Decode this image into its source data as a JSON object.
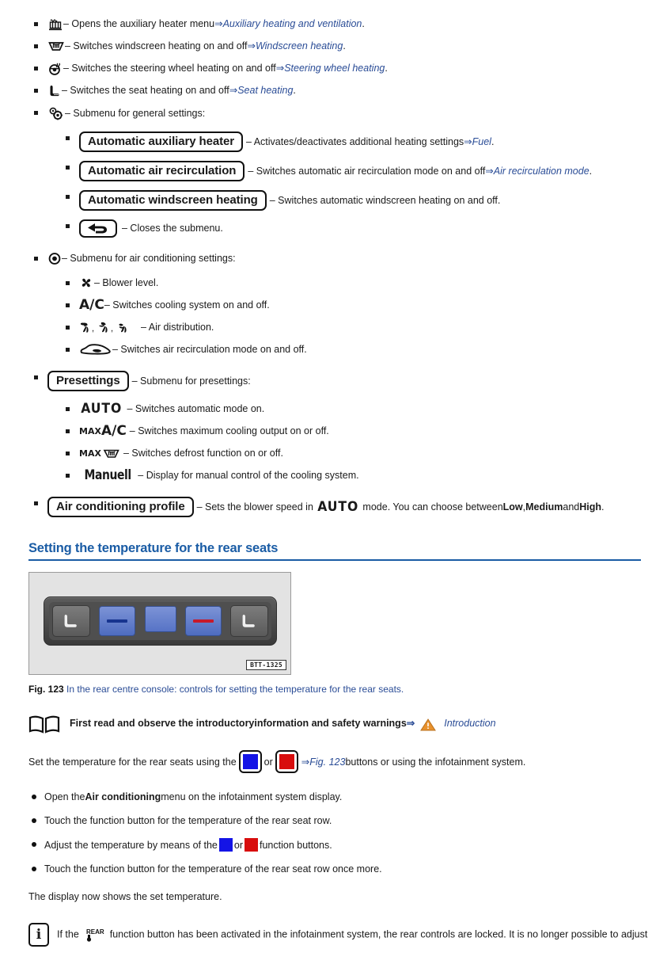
{
  "top_list": [
    {
      "icon": "auxiliary-heater-icon",
      "text": " – Opens the auxiliary heater menu ",
      "ref_arrow": "⇒ ",
      "ref": "Auxiliary heating and ventilation",
      "tail": "."
    },
    {
      "icon": "windscreen-heating-icon",
      "text": " – Switches windscreen heating on and off ",
      "ref_arrow": "⇒ ",
      "ref": "Windscreen heating",
      "tail": "."
    },
    {
      "icon": "steering-wheel-heating-icon",
      "text": " – Switches the steering wheel heating on and off ",
      "ref_arrow": "⇒ ",
      "ref": "Steering wheel heating",
      "tail": "."
    },
    {
      "icon": "seat-heating-icon",
      "text": " – Switches the seat heating on and off ",
      "ref_arrow": "⇒ ",
      "ref": "Seat heating",
      "tail": "."
    },
    {
      "icon": "general-settings-gear-icon",
      "text": " – Submenu for general settings:",
      "ref_arrow": "",
      "ref": "",
      "tail": ""
    }
  ],
  "general_settings": [
    {
      "label": "Automatic auxiliary heater",
      "text": " – Activates/deactivates additional heating settings ",
      "ref_arrow": "⇒ ",
      "ref": "Fuel",
      "tail": "."
    },
    {
      "label": "Automatic air recirculation",
      "text": " – Switches automatic air recirculation mode on and off ",
      "ref_arrow": "⇒ ",
      "ref": "Air recirculation mode",
      "tail": "."
    },
    {
      "label": "Automatic windscreen heating",
      "text": " – Switches automatic windscreen heating on and off.",
      "ref_arrow": "",
      "ref": "",
      "tail": ""
    },
    {
      "label": "",
      "icon": "back-arrow-icon",
      "text": " – Closes the submenu.",
      "ref_arrow": "",
      "ref": "",
      "tail": ""
    }
  ],
  "ac_settings_header": {
    "icon": "target-dot-icon",
    "text": " – Submenu for air conditioning settings:"
  },
  "ac_settings": [
    {
      "icon": "blower-fan-icon",
      "text": " – Blower level."
    },
    {
      "icon": "ac-text-icon",
      "text": " – Switches cooling system on and off."
    },
    {
      "icon": "air-distribution-icons",
      "text": " – Air distribution."
    },
    {
      "icon": "air-recirculation-car-icon",
      "text": " – Switches air recirculation mode on and off."
    }
  ],
  "presettings_header": {
    "label": "Presettings",
    "text": " – Submenu for presettings:"
  },
  "presettings": [
    {
      "icon": "auto-text-icon",
      "glyph": "AUTO",
      "text": " – Switches automatic mode on."
    },
    {
      "icon": "max-ac-text-icon",
      "glyph_max": "MAX",
      "glyph": "A/C",
      "text": " – Switches maximum cooling output on or off."
    },
    {
      "icon": "max-defrost-icon",
      "glyph_max": "MAX",
      "text": " – Switches defrost function on or off."
    },
    {
      "icon": "manuell-text-icon",
      "glyph": "Manuell",
      "text": " – Display for manual control of the cooling system."
    }
  ],
  "profile_item": {
    "label": "Air conditioning profile",
    "text_before": " – Sets the blower speed in ",
    "auto_glyph": "AUTO",
    "text_mid": " mode. You can choose between",
    "opt_low": "Low",
    "sep1": ", ",
    "opt_medium": "Medium",
    "sep2": " and ",
    "opt_high": "High",
    "tail": "."
  },
  "section": {
    "title": "Setting the temperature for the rear seats"
  },
  "figure": {
    "tag": "BTT-1325",
    "caption_label": "Fig. 123",
    "caption_text": " In the rear centre console: controls for setting the temperature for the rear seats."
  },
  "intro_note": {
    "icon": "book-icon",
    "text": "First read and observe the introductoryinformation and safety warnings",
    "arrow": "⇒",
    "warn_icon": "warning-triangle-icon",
    "link": "Introduction"
  },
  "set_temp_para": {
    "before": "Set the temperature for the rear seats using the ",
    "or": " or ",
    "ref_arrow": "⇒ ",
    "ref": "Fig. 123",
    "after": " buttons or using the infotainment system."
  },
  "steps": [
    {
      "before": "Open the ",
      "bold": "Air conditioning",
      "after": " menu on the infotainment system display."
    },
    {
      "before": "Touch the function button for the temperature of the rear seat row.",
      "bold": "",
      "after": ""
    },
    {
      "before": "Adjust the temperature by means of the ",
      "bold": "",
      "after": " function buttons.",
      "mid_or": " or ",
      "has_swatches": true
    },
    {
      "before": "Touch the function button for the temperature of the rear seat row once more.",
      "bold": "",
      "after": ""
    }
  ],
  "display_line": "The display now shows the set temperature.",
  "info_note": {
    "icon": "info-icon",
    "glyph": "i",
    "before": "If the ",
    "rear_icon": "rear-function-icon",
    "rear_label": "REAR",
    "after": " function button has been activated in the infotainment system, the rear controls are locked. It is no longer possible to adjust"
  },
  "colors": {
    "heading_blue": "#1a5ca5",
    "link_blue": "#2a4c96",
    "warning_orange": "#e8912d",
    "swatch_blue": "#1414e6",
    "swatch_red": "#d80d0d"
  }
}
